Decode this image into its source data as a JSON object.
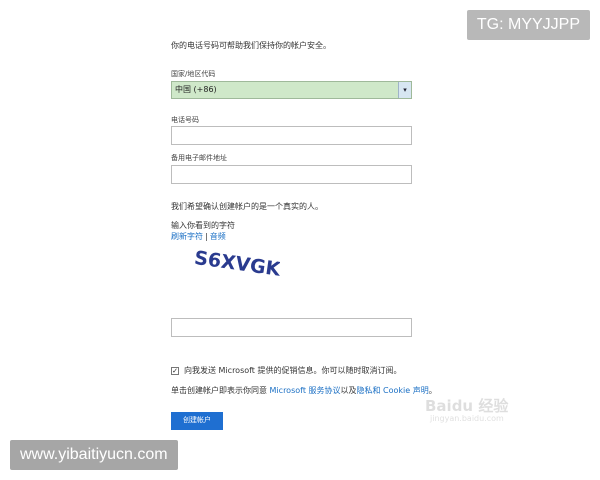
{
  "overlay": {
    "tg_badge": "TG: MYYJJPP",
    "site_badge": "www.yibaitiyucn.com"
  },
  "form": {
    "intro": "你的电话号码可帮助我们保持你的帐户安全。",
    "country": {
      "label": "国家/地区代码",
      "selected": "中国 (+86)",
      "arrow": "▾"
    },
    "phone": {
      "label": "电话号码",
      "value": ""
    },
    "backup_email": {
      "label": "备用电子邮件地址",
      "value": ""
    },
    "verify_text": "我们希望确认创建帐户的是一个真实的人。",
    "captcha": {
      "prompt": "输入你看到的字符",
      "refresh_link": "刷新字符",
      "separator": "|",
      "audio_link": "音频",
      "image_text": "S6XVGK"
    },
    "captcha_input": {
      "value": ""
    },
    "promo_check": {
      "checked_mark": "✓",
      "label": "向我发送 Microsoft 提供的促销信息。你可以随时取消订阅。"
    },
    "terms": {
      "prefix": "单击创建帐户即表示你同意 ",
      "link1": "Microsoft 服务协议",
      "mid": "以及",
      "link2": "隐私和 Cookie 声明",
      "suffix": "。"
    },
    "create_button": "创建帐户"
  },
  "watermark": {
    "main": "Baidu 经验",
    "sub": "jingyan.baidu.com"
  },
  "colors": {
    "accent": "#1f6fd1",
    "link": "#1a6fc4",
    "select_bg": "#cfe8c9"
  }
}
